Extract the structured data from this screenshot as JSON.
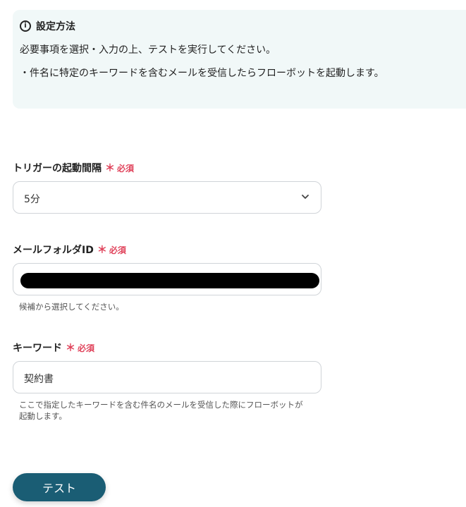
{
  "info": {
    "title": "設定方法",
    "line1": "必要事項を選択・入力の上、テストを実行してください。",
    "line2": "・件名に特定のキーワードを含むメールを受信したらフローボットを起動します。"
  },
  "fields": {
    "interval": {
      "label": "トリガーの起動間隔",
      "required": "必須",
      "value": "5分"
    },
    "folder_id": {
      "label": "メールフォルダID",
      "required": "必須",
      "value": "",
      "hint": "候補から選択してください。"
    },
    "keyword": {
      "label": "キーワード",
      "required": "必須",
      "value": "契約書",
      "hint_line1": "ここで指定したキーワードを含む件名のメールを受信した際にフローボットが",
      "hint_line2": "起動します。"
    }
  },
  "actions": {
    "test_label": "テスト"
  },
  "icons": {
    "info": "info-circle-icon",
    "chevron": "chevron-down-icon",
    "required": "asterisk-icon"
  },
  "colors": {
    "info_bg": "#f1f8f8",
    "required": "#e0435b",
    "button": "#1a5d74"
  }
}
